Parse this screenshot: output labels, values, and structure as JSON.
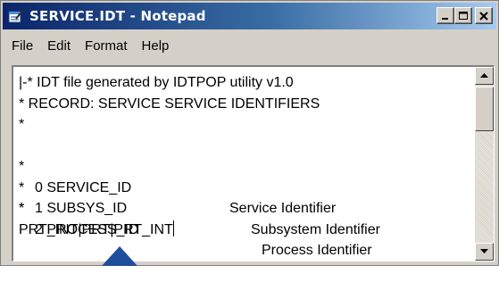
{
  "window": {
    "title": "SERVICE.IDT - Notepad",
    "title_bar_color": "#0a246a"
  },
  "menu": {
    "items": [
      {
        "label": "File"
      },
      {
        "label": "Edit"
      },
      {
        "label": "Format"
      },
      {
        "label": "Help"
      }
    ]
  },
  "editor": {
    "line1": "|-* IDT file generated by IDTPOP utility v1.0",
    "line2": "* RECORD: SERVICE SERVICE IDENTIFIERS",
    "line3": "*",
    "rows": [
      {
        "star": "*",
        "code": "0 SERVICE_ID",
        "desc": "Service Identifier"
      },
      {
        "star": "*",
        "code": "1 SUBSYS_ID",
        "desc": "Subsystem Identifier"
      },
      {
        "star": "*",
        "code": "2 PROCESS_ID",
        "desc": "Process Identifier"
      }
    ],
    "line7": "*",
    "line8": "PRT_INT|PRT|PRT_INT"
  },
  "pointer_color": "#1f4e9c"
}
